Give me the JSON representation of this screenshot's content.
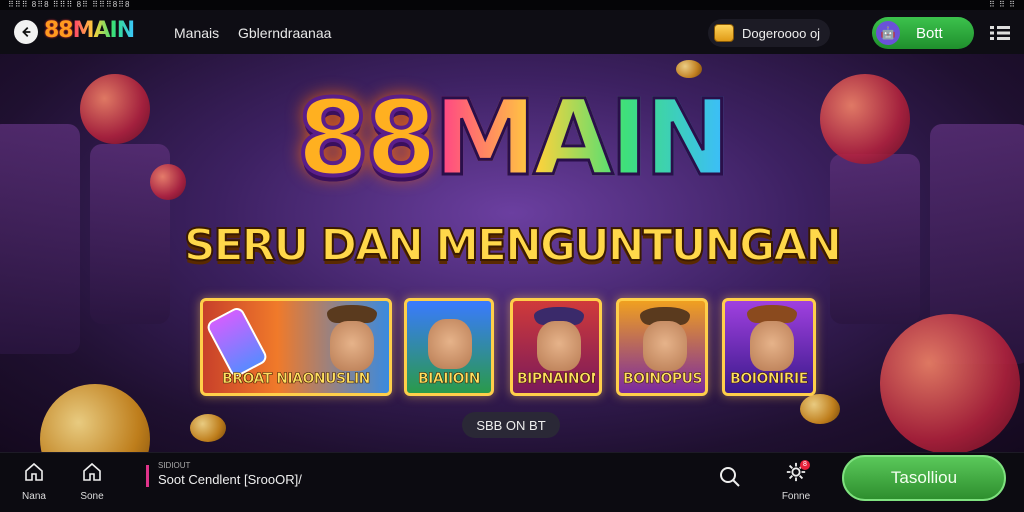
{
  "status": {
    "left": "⠿⠿⠿ 8⠿8 ⠿⠿⠿ 8⠿ ⠿⠿⠿8⠿8",
    "right": "⠿ ⠿ ⠿"
  },
  "header": {
    "logo_prefix": "88",
    "logo_main": "MAIN",
    "nav_1": "Manais",
    "nav_2": "Gblerndraanaa",
    "wallet_text": "Dogeroooo oj",
    "bot_button": "Bott",
    "bot_avatar": "🤖"
  },
  "hero": {
    "title_88": "88",
    "title_main": "MAIN",
    "subtitle": "SERU DAN MENGUNTUNGAN",
    "cards": [
      {
        "label": "BROAT  NIAONUSLIN"
      },
      {
        "label": "BIAIIOIN"
      },
      {
        "label": "BIPNAINONIB"
      },
      {
        "label": "BOINOPUS"
      },
      {
        "label": "BOIONIRIE"
      }
    ],
    "pill": "SBB ON BT"
  },
  "bottom": {
    "nav_home": "Nana",
    "nav_second": "Sone",
    "context_small": "SIDIOUT",
    "context_main": "Soot Cendlent [SrooOR]/",
    "settings_label": "Fonne",
    "settings_badge": "8",
    "cta": "Tasolliou"
  },
  "colors": {
    "accent_green": "#2e8f2e",
    "gold": "#ffcf4a",
    "purple_bg": "#3d2162"
  }
}
